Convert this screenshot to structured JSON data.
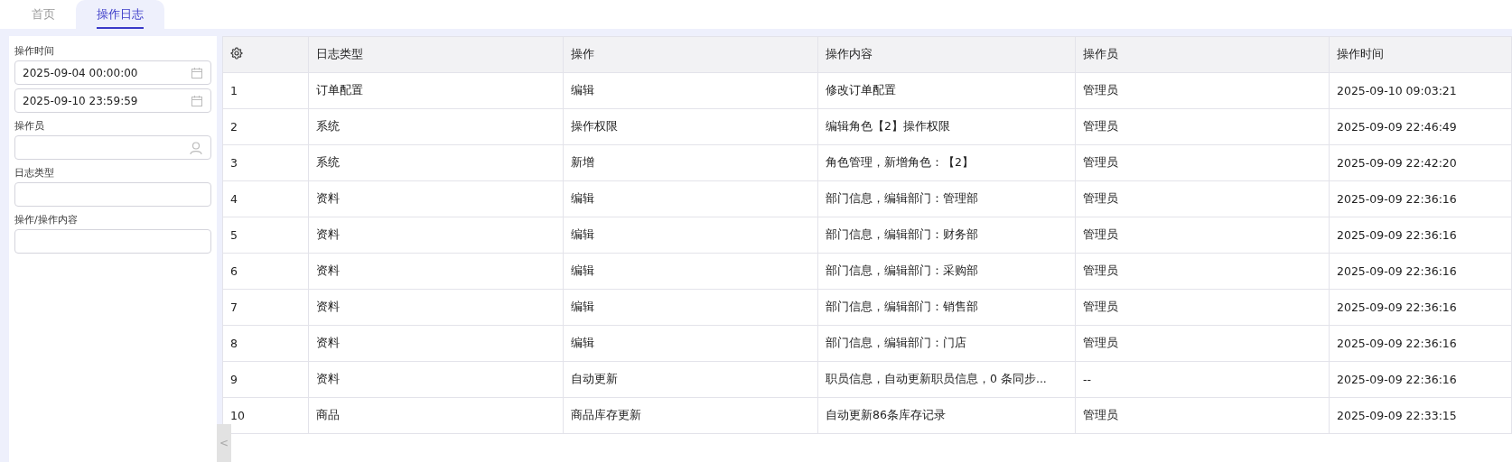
{
  "tabs": [
    {
      "label": "首页",
      "selected": false
    },
    {
      "label": "操作日志",
      "selected": true
    }
  ],
  "filters": [
    {
      "kind": "date",
      "label": "操作时间",
      "value": "2025-09-04 00:00:00"
    },
    {
      "kind": "date",
      "value": "2025-09-10 23:59:59"
    },
    {
      "kind": "user",
      "label": "操作员"
    },
    {
      "kind": "text",
      "label": "日志类型"
    },
    {
      "kind": "text",
      "label": "操作/操作内容"
    }
  ],
  "table": {
    "columns": [
      "",
      "日志类型",
      "操作",
      "操作内容",
      "操作员",
      "操作时间"
    ],
    "rows": [
      [
        "1",
        "订单配置",
        "编辑",
        "修改订单配置",
        "管理员",
        "2025-09-10 09:03:21"
      ],
      [
        "2",
        "系统",
        "操作权限",
        "编辑角色【2】操作权限",
        "管理员",
        "2025-09-09 22:46:49"
      ],
      [
        "3",
        "系统",
        "新增",
        "角色管理，新增角色：【2】",
        "管理员",
        "2025-09-09 22:42:20"
      ],
      [
        "4",
        "资料",
        "编辑",
        "部门信息，编辑部门：管理部",
        "管理员",
        "2025-09-09 22:36:16"
      ],
      [
        "5",
        "资料",
        "编辑",
        "部门信息，编辑部门：财务部",
        "管理员",
        "2025-09-09 22:36:16"
      ],
      [
        "6",
        "资料",
        "编辑",
        "部门信息，编辑部门：采购部",
        "管理员",
        "2025-09-09 22:36:16"
      ],
      [
        "7",
        "资料",
        "编辑",
        "部门信息，编辑部门：销售部",
        "管理员",
        "2025-09-09 22:36:16"
      ],
      [
        "8",
        "资料",
        "编辑",
        "部门信息，编辑部门：门店",
        "管理员",
        "2025-09-09 22:36:16"
      ],
      [
        "9",
        "资料",
        "自动更新",
        "职员信息，自动更新职员信息，0 条同步...",
        "--",
        "2025-09-09 22:36:16"
      ],
      [
        "10",
        "商品",
        "商品库存更新",
        "自动更新86条库存记录",
        "管理员",
        "2025-09-09 22:33:15"
      ]
    ]
  },
  "collapse_handle": "<"
}
